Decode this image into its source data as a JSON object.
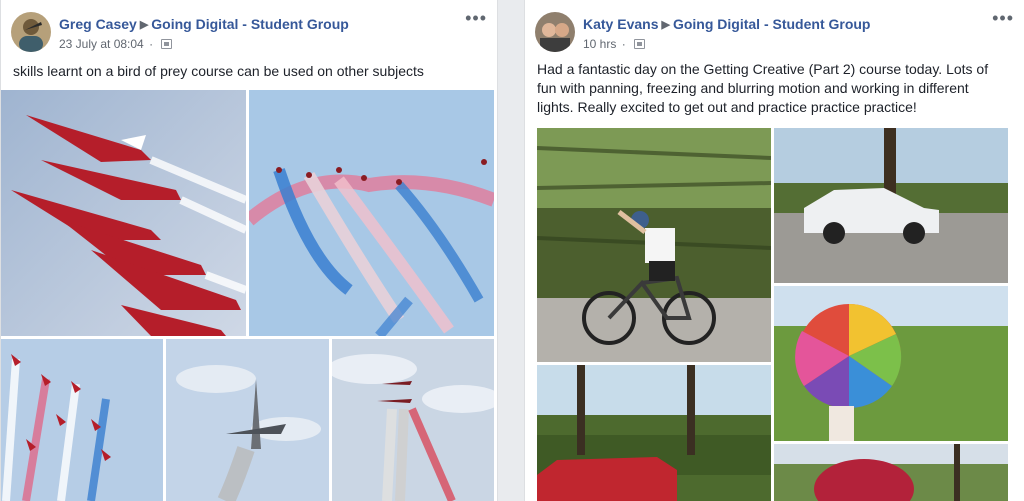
{
  "posts": [
    {
      "author": "Greg Casey",
      "group": "Going Digital - Student Group",
      "timestamp": "23 July at 08:04",
      "audience_icon": "group-icon",
      "text": "skills learnt on a bird of prey course can be used on other subjects",
      "photos": [
        "red-arrows-formation-close",
        "red-arrows-smoke-trails-sky",
        "red-arrows-diving-smoke",
        "jet-climbing-smoke",
        "jets-vertical-smoke-trails"
      ]
    },
    {
      "author": "Katy Evans",
      "group": "Going Digital - Student Group",
      "timestamp": "10 hrs",
      "audience_icon": "group-icon",
      "text": "Had a fantastic day on the Getting Creative (Part 2) course today. Lots of fun with panning, freezing and blurring motion and working in different lights. Really excited to get out and practice practice practice!",
      "photos": [
        "cyclist-panning-blur",
        "white-pickup-truck-motion",
        "rainbow-umbrella-spinning",
        "red-car-blurred-trees",
        "red-umbrella-woods"
      ]
    }
  ],
  "colors": {
    "link": "#365899",
    "meta": "#616770",
    "text": "#1d2129",
    "background": "#e9ebee"
  }
}
